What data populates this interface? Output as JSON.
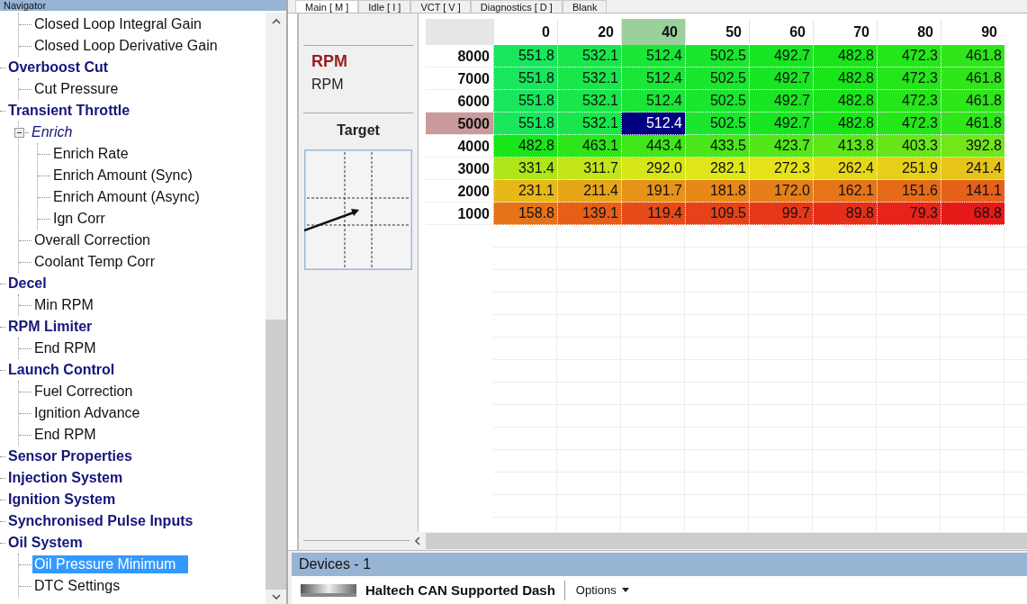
{
  "navigator": {
    "title": "Navigator"
  },
  "tree": [
    {
      "children": [
        {
          "label": "Closed Loop Integral Gain",
          "selected": false
        },
        {
          "label": "Closed Loop Derivative Gain",
          "selected": false
        }
      ]
    },
    {
      "label": "Overboost Cut",
      "kind": "group",
      "selected": false,
      "children": [
        {
          "label": "Cut Pressure",
          "selected": false
        }
      ]
    },
    {
      "label": "Transient Throttle",
      "kind": "group",
      "selected": false,
      "children": [
        {
          "label": "Enrich",
          "kind": "subgroup",
          "expanded": true,
          "selected": false,
          "children": [
            {
              "label": "Enrich Rate",
              "selected": false
            },
            {
              "label": "Enrich Amount (Sync)",
              "selected": false
            },
            {
              "label": "Enrich Amount (Async)",
              "selected": false
            },
            {
              "label": "Ign Corr",
              "selected": false
            }
          ]
        },
        {
          "label": "Overall Correction",
          "selected": false
        },
        {
          "label": "Coolant Temp Corr",
          "selected": false
        }
      ]
    },
    {
      "label": "Decel",
      "kind": "group",
      "selected": false,
      "children": [
        {
          "label": "Min RPM",
          "selected": false
        }
      ]
    },
    {
      "label": "RPM Limiter",
      "kind": "group",
      "selected": false,
      "children": [
        {
          "label": "End RPM",
          "selected": false
        }
      ]
    },
    {
      "label": "Launch Control",
      "kind": "group",
      "selected": false,
      "children": [
        {
          "label": "Fuel Correction",
          "selected": false
        },
        {
          "label": "Ignition Advance",
          "selected": false
        },
        {
          "label": "End RPM",
          "selected": false
        }
      ]
    },
    {
      "label": "Sensor Properties",
      "kind": "group",
      "selected": false
    },
    {
      "label": "Injection System",
      "kind": "group",
      "selected": false
    },
    {
      "label": "Ignition System",
      "kind": "group",
      "selected": false
    },
    {
      "label": "Synchronised Pulse Inputs",
      "kind": "group",
      "selected": false
    },
    {
      "label": "Oil System",
      "kind": "group",
      "selected": false,
      "children": [
        {
          "label": "Oil Pressure Minimum",
          "selected": true
        },
        {
          "label": "DTC Settings",
          "selected": false
        }
      ]
    }
  ],
  "tabs": [
    {
      "label": "Main [ M ]",
      "selected": true
    },
    {
      "label": "Idle [ I ]",
      "selected": false
    },
    {
      "label": "VCT [ V ]",
      "selected": false
    },
    {
      "label": "Diagnostics [ D ]",
      "selected": false
    },
    {
      "label": "Blank",
      "selected": false
    }
  ],
  "axis_panel": {
    "axis_title": "RPM",
    "axis_unit": "RPM",
    "target_label": "Target"
  },
  "table": {
    "columns": [
      {
        "label": "0",
        "selected": false
      },
      {
        "label": "20",
        "selected": false
      },
      {
        "label": "40",
        "selected": true
      },
      {
        "label": "50",
        "selected": false
      },
      {
        "label": "60",
        "selected": false
      },
      {
        "label": "70",
        "selected": false
      },
      {
        "label": "80",
        "selected": false
      },
      {
        "label": "90",
        "selected": false
      }
    ],
    "rows": [
      {
        "label": "8000",
        "selected": false,
        "cells": [
          "551.8",
          "532.1",
          "512.4",
          "502.5",
          "492.7",
          "482.8",
          "472.3",
          "461.8"
        ]
      },
      {
        "label": "7000",
        "selected": false,
        "cells": [
          "551.8",
          "532.1",
          "512.4",
          "502.5",
          "492.7",
          "482.8",
          "472.3",
          "461.8"
        ]
      },
      {
        "label": "6000",
        "selected": false,
        "cells": [
          "551.8",
          "532.1",
          "512.4",
          "502.5",
          "492.7",
          "482.8",
          "472.3",
          "461.8"
        ]
      },
      {
        "label": "5000",
        "selected": true,
        "cells": [
          "551.8",
          "532.1",
          "512.4",
          "502.5",
          "492.7",
          "482.8",
          "472.3",
          "461.8"
        ]
      },
      {
        "label": "4000",
        "selected": false,
        "cells": [
          "482.8",
          "463.1",
          "443.4",
          "433.5",
          "423.7",
          "413.8",
          "403.3",
          "392.8"
        ]
      },
      {
        "label": "3000",
        "selected": false,
        "cells": [
          "331.4",
          "311.7",
          "292.0",
          "282.1",
          "272.3",
          "262.4",
          "251.9",
          "241.4"
        ]
      },
      {
        "label": "2000",
        "selected": false,
        "cells": [
          "231.1",
          "211.4",
          "191.7",
          "181.8",
          "172.0",
          "162.1",
          "151.6",
          "141.1"
        ]
      },
      {
        "label": "1000",
        "selected": false,
        "cells": [
          "158.8",
          "139.1",
          "119.4",
          "109.5",
          "99.7",
          "89.8",
          "79.3",
          "68.8"
        ]
      }
    ]
  },
  "devices": {
    "title": "Devices - 1",
    "device_name": "Haltech CAN Supported Dash",
    "options_label": "Options"
  }
}
